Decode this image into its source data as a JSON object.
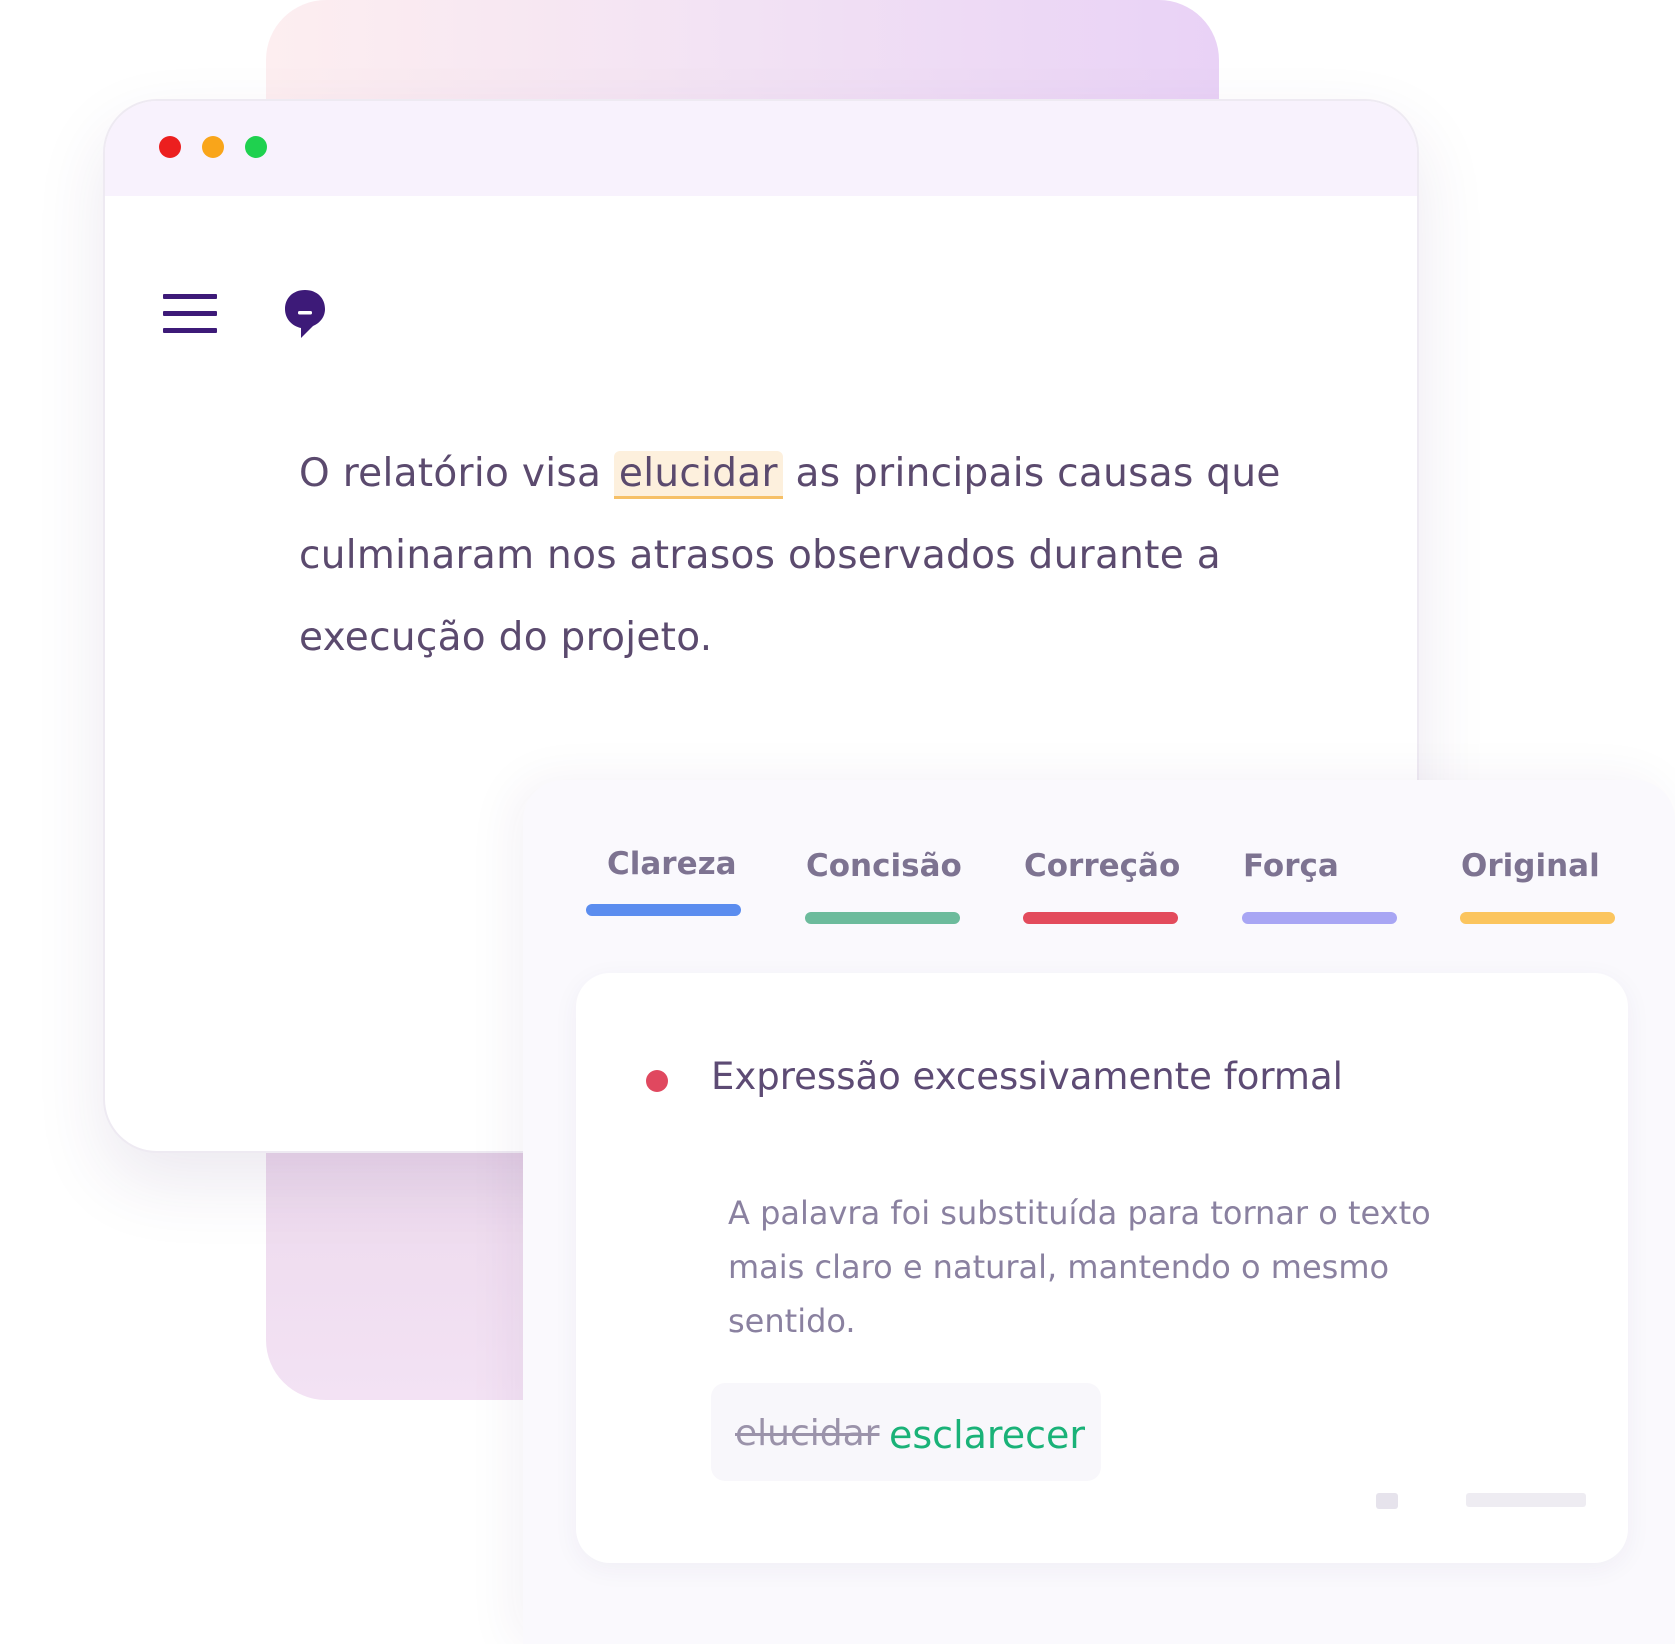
{
  "document": {
    "text_before": "O relatório visa ",
    "highlight": "elucidar",
    "text_after": " as principais causas que culminaram nos atrasos observados durante a execução do projeto."
  },
  "icons": {
    "menu": "hamburger-menu-icon",
    "logo": "speech-bubble-logo-icon"
  },
  "tabs": [
    {
      "label": "Clareza",
      "color": "#5b8def"
    },
    {
      "label": "Concisão",
      "color": "#6cbb9c"
    },
    {
      "label": "Correção",
      "color": "#e34b5c"
    },
    {
      "label": "Força",
      "color": "#a8a6f4"
    },
    {
      "label": "Original",
      "color": "#fbc55e"
    }
  ],
  "suggestion_card": {
    "title": "Expressão excessivamente formal",
    "description": "A palavra foi substituída para tornar o texto mais claro e natural, mantendo o mesmo sentido.",
    "original_word": "elucidar",
    "replacement_word": "esclarecer",
    "alert_color": "#e0485f"
  }
}
